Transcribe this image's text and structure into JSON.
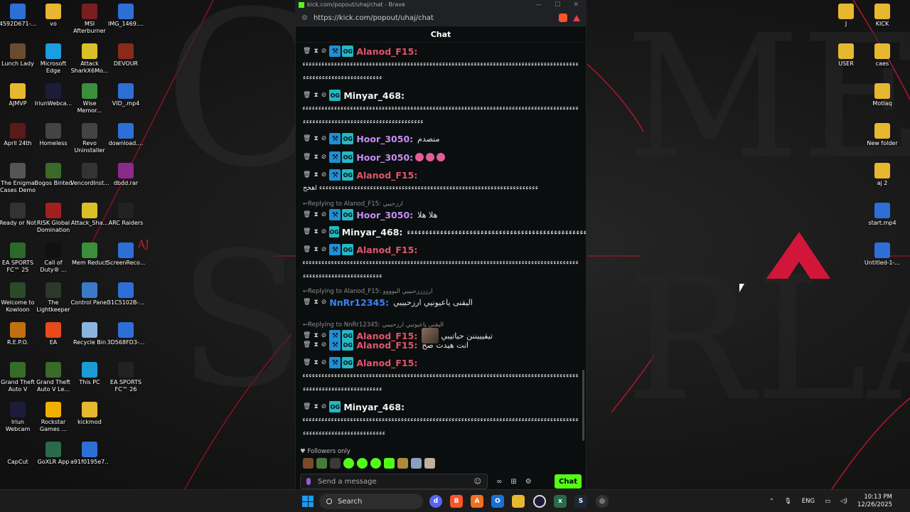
{
  "browser": {
    "window_title": "kick.com/popout/uhaj/chat - Brave",
    "url": "https://kick.com/popout/uhaj/chat"
  },
  "chat": {
    "header": "Chat",
    "followers_only": "Followers only",
    "input_placeholder": "Send a message",
    "send_label": "Chat",
    "messages": [
      {
        "user": "Alanod_F15:",
        "line2": "ءءءءءءءءءءءءءءءءءءءءءءءءءءءءءءءءءءءءءءءءءءءءءءءءءءءءءءءءءءءءءءءءءءءءءءءءءءءءءءءءءءءءءءءءءءءءءءءءءءء",
        "line3": "ءءءءءءءءءءءءءءءءءءءءءءءءء"
      },
      {
        "user": "Minyar_468:",
        "line2": "ءءءءءءءءءءءءءءءءءءءءءءءءءءءءءءءءءءءءءءءءءءءءءءءءءءءءءءءءءءءءءءءءءءءءءءءءءءءءءءءءءءءءءءءءءءءءءءءءءءء",
        "line3": "ءءءءءءءءءءءءءءءءءءءءءءءءءءءءءءءءءءءءءء"
      },
      {
        "user": "Hoor_3050:",
        "text": "منصدم"
      },
      {
        "user": "Hoor_3050:",
        "text": ""
      },
      {
        "user": "Alanod_F15:",
        "line2": "ءءءءءءءءءءءءءءءءءءءءءءءءءءءءءءءءءءءءءءءءءءءءءءءءءءءءءءءءءءءءءءءءءءءءء اهخخ"
      },
      {
        "reply": "Replying to Alanod_F15: ارزحبيي",
        "user": "Hoor_3050:",
        "text": "هلا هلا"
      },
      {
        "user": "Minyar_468:",
        "text": "ءءءءءءءءءءءءءءءءءءءءءءءءءءءءءءءءءءءءءءءءءءءءءءءءءءءءء"
      },
      {
        "user": "Alanod_F15:",
        "line2": "ءءءءءءءءءءءءءءءءءءءءءءءءءءءءءءءءءءءءءءءءءءءءءءءءءءءءءءءءءءءءءءءءءءءءءءءءءءءءءءءءءءءءءءءءءءءءءءءءءءءء",
        "line3": "ءءءءءءءءءءءءءءءءءءءءءءءءء"
      },
      {
        "reply": "Replying to Alanod_F15: ارززززحبيبي البوووو",
        "user": "NnRr12345:",
        "text": "اليقنى ياعيونيي ارزحبيبي"
      },
      {
        "reply": "Replying to NnRr12345: اليقنى ياعيونيي ارزحبيبي",
        "user": "Alanod_F15:",
        "text": "تيقيييننن حياتيبي"
      },
      {
        "user": "Alanod_F15:",
        "text": "انت هيدت صح"
      },
      {
        "user": "Alanod_F15:",
        "line2": "ءءءءءءءءءءءءءءءءءءءءءءءءءءءءءءءءءءءءءءءءءءءءءءءءءءءءءءءءءءءءءءءءءءءءءءءءءءءءءءءءءءءءءءءءءءءءءءءءءءءء",
        "line3": "ءءءءءءءءءءءءءءءءءءءءءءءءء"
      },
      {
        "user": "Minyar_468:",
        "line2": "ءءءءءءءءءءءءءءءءءءءءءءءءءءءءءءءءءءءءءءءءءءءءءءءءءءءءءءءءءءءءءءءءءءءءءءءءءءءءءءءءءءءءءءءءءءءءءءءءءءءء",
        "line3": "ءءءءءءءءءءءءءءءءءءءءءءءءءء"
      }
    ]
  },
  "desktop_left": [
    {
      "label": "4592D671-...",
      "icon": "file-icon",
      "color": "#2d6fd6"
    },
    {
      "label": "vo",
      "icon": "folder-icon",
      "color": "#e8b730"
    },
    {
      "label": "MSI Afterburner",
      "icon": "msi-icon",
      "color": "#7a1e1e"
    },
    {
      "label": "IMG_1469....",
      "icon": "file-icon",
      "color": "#2d6fd6"
    },
    {
      "label": "Lunch Lady",
      "icon": "game-icon",
      "color": "#6b4b2e"
    },
    {
      "label": "Microsoft Edge",
      "icon": "edge-icon",
      "color": "#1b9de2"
    },
    {
      "label": "Attack SharkX6Mo...",
      "icon": "shark-icon",
      "color": "#d9c027"
    },
    {
      "label": "DEVOUR",
      "icon": "game-icon",
      "color": "#8a2a1a"
    },
    {
      "label": "AJMVP",
      "icon": "folder-icon",
      "color": "#e8b730"
    },
    {
      "label": "IriunWebca...",
      "icon": "webcam-icon",
      "color": "#1c1c3a"
    },
    {
      "label": "Wise Memor...",
      "icon": "app-icon",
      "color": "#3a8f3a"
    },
    {
      "label": "VID_.mp4",
      "icon": "video-icon",
      "color": "#2d6fd6"
    },
    {
      "label": "April 24th",
      "icon": "game-icon",
      "color": "#5a1a1a"
    },
    {
      "label": "Homeless",
      "icon": "game-icon",
      "color": "#444"
    },
    {
      "label": "Revo Uninstaller",
      "icon": "app-icon",
      "color": "#444"
    },
    {
      "label": "download....",
      "icon": "file-icon",
      "color": "#2d6fd6"
    },
    {
      "label": "The Enigma Cases Demo",
      "icon": "game-icon",
      "color": "#555"
    },
    {
      "label": "Bogos Binted",
      "icon": "game-icon",
      "color": "#3a6a2a"
    },
    {
      "label": "VencordInst...",
      "icon": "app-icon",
      "color": "#333"
    },
    {
      "label": "dbdd.rar",
      "icon": "archive-icon",
      "color": "#8a2a8a"
    },
    {
      "label": "Ready or Not",
      "icon": "game-icon",
      "color": "#333"
    },
    {
      "label": "RISK Global Domination",
      "icon": "game-icon",
      "color": "#a02020"
    },
    {
      "label": "Attack_Sha...",
      "icon": "shark-icon",
      "color": "#d9c027"
    },
    {
      "label": "ARC Raiders",
      "icon": "game-icon",
      "color": "#222"
    },
    {
      "label": "EA SPORTS FC™ 25",
      "icon": "game-icon",
      "color": "#2a6a2a"
    },
    {
      "label": "Call of Duty® ...",
      "icon": "game-icon",
      "color": "#111"
    },
    {
      "label": "Mem Reduct",
      "icon": "app-icon",
      "color": "#3a8f3a"
    },
    {
      "label": "ScreenReco...",
      "icon": "video-icon",
      "color": "#2d6fd6"
    },
    {
      "label": "Welcome to Kowloon",
      "icon": "game-icon",
      "color": "#2a4a2a"
    },
    {
      "label": "The Lightkeeper",
      "icon": "game-icon",
      "color": "#2a3a2a"
    },
    {
      "label": "Control Panel",
      "icon": "control-panel-icon",
      "color": "#3a7ac8"
    },
    {
      "label": "31C5102B-...",
      "icon": "file-icon",
      "color": "#2d6fd6"
    },
    {
      "label": "R.E.P.O.",
      "icon": "game-icon",
      "color": "#c07010"
    },
    {
      "label": "EA",
      "icon": "ea-icon",
      "color": "#e84a1a"
    },
    {
      "label": "Recycle Bin",
      "icon": "recycle-bin-icon",
      "color": "#8ab4e0"
    },
    {
      "label": "3D568FD3-...",
      "icon": "file-icon",
      "color": "#2d6fd6"
    },
    {
      "label": "Grand Theft Auto V",
      "icon": "game-icon",
      "color": "#3a6a2a"
    },
    {
      "label": "Grand Theft Auto V Le...",
      "icon": "game-icon",
      "color": "#3a6a2a"
    },
    {
      "label": "This PC",
      "icon": "pc-icon",
      "color": "#1a9bd6"
    },
    {
      "label": "EA SPORTS FC™ 26",
      "icon": "game-icon",
      "color": "#222"
    },
    {
      "label": "Iriun Webcam",
      "icon": "webcam-icon",
      "color": "#1c1c3a"
    },
    {
      "label": "Rockstar Games ...",
      "icon": "rockstar-icon",
      "color": "#f0b000"
    },
    {
      "label": "kickmod",
      "icon": "folder-icon",
      "color": "#e8b730"
    },
    {
      "label": "",
      "icon": "",
      "color": ""
    },
    {
      "label": "CapCut",
      "icon": "capcut-icon",
      "color": "#111"
    },
    {
      "label": "GoXLR App",
      "icon": "app-icon",
      "color": "#2a6a4a"
    },
    {
      "label": "a91f0195e7...",
      "icon": "file-icon",
      "color": "#2d6fd6"
    }
  ],
  "desktop_right": [
    {
      "label": "J",
      "icon": "folder-icon",
      "color": "#e8b730"
    },
    {
      "label": "KICK",
      "icon": "folder-icon",
      "color": "#e8b730"
    },
    {
      "label": "USER",
      "icon": "folder-icon",
      "color": "#e8b730"
    },
    {
      "label": "caes",
      "icon": "folder-icon",
      "color": "#e8b730"
    },
    {
      "label": "Motlaq",
      "icon": "folder-icon",
      "color": "#e8b730"
    },
    {
      "label": "New folder",
      "icon": "folder-icon",
      "color": "#e8b730"
    },
    {
      "label": "aj 2",
      "icon": "folder-icon",
      "color": "#e8b730"
    },
    {
      "label": "start.mp4",
      "icon": "video-icon",
      "color": "#2d6fd6"
    },
    {
      "label": "Untitled-1-...",
      "icon": "video-icon",
      "color": "#2d6fd6"
    }
  ],
  "wallpaper": {
    "overlay_text": "AJ"
  },
  "taskbar": {
    "search_label": "Search",
    "language": "ENG",
    "time": "10:13 PM",
    "date": "12/26/2025"
  },
  "colors": {
    "kick_green": "#53fc18",
    "alanod": "#e0556b",
    "minyar": "#f2f2f2",
    "hoor": "#c68df5",
    "nnrr": "#3b82f6"
  }
}
